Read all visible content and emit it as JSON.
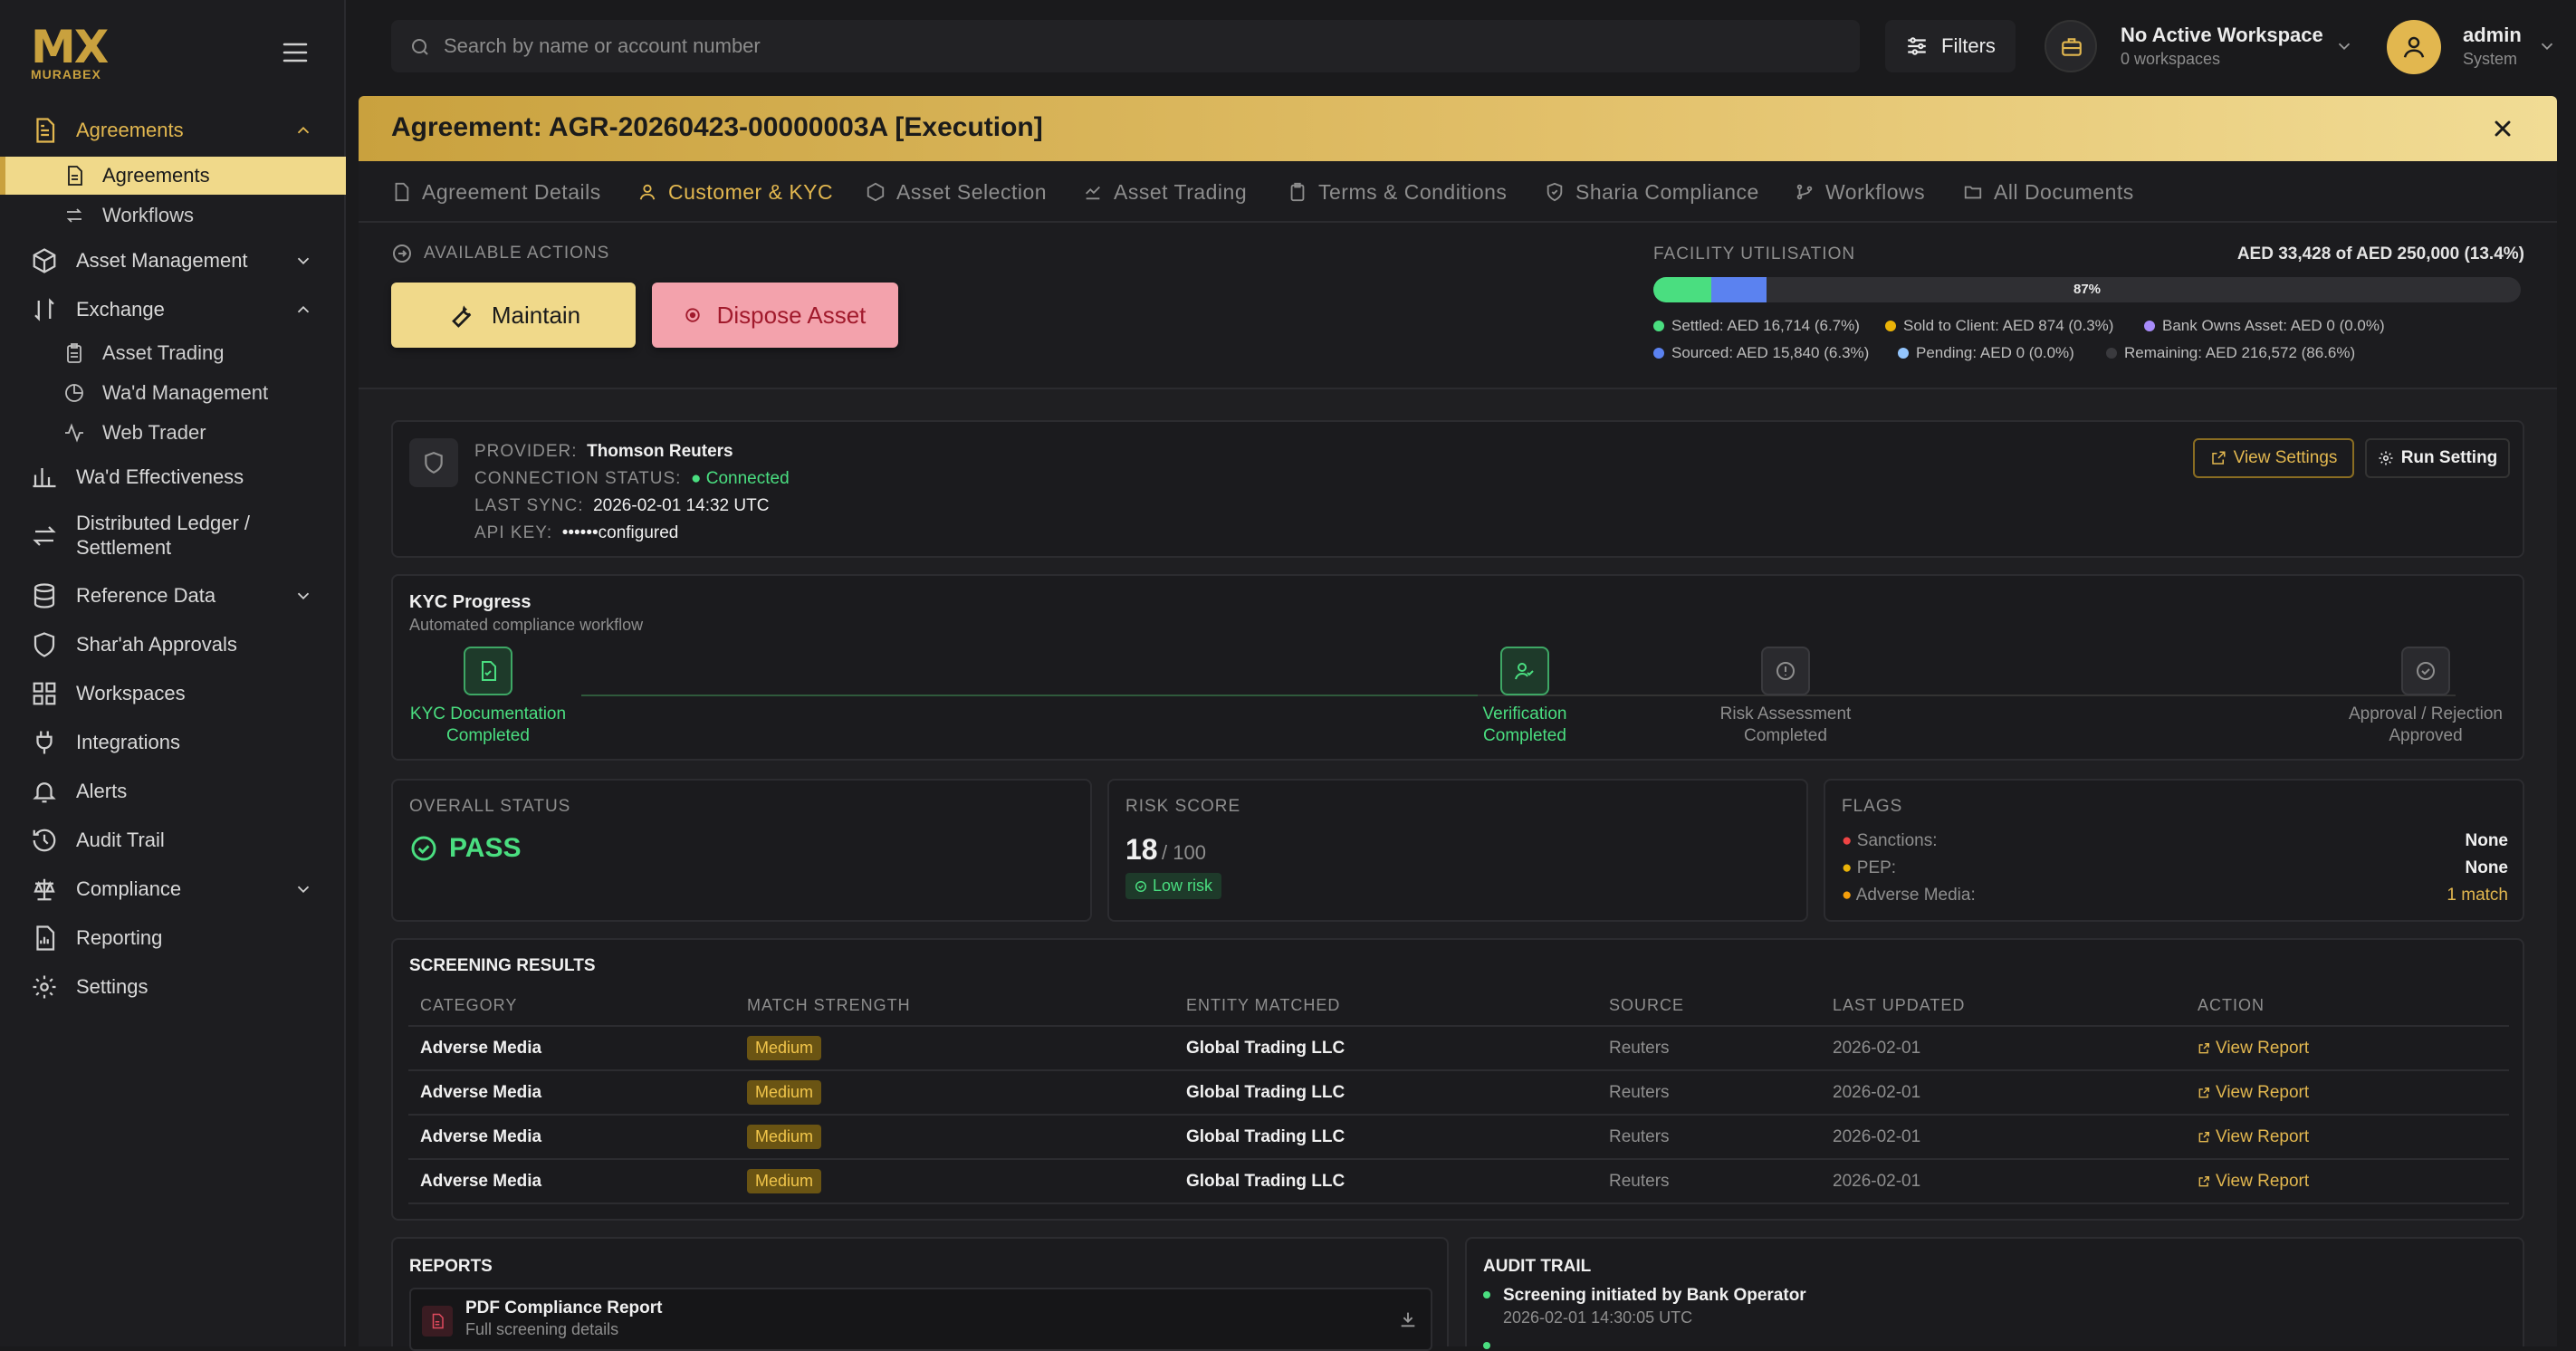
{
  "app": {
    "logo_mark": "MX",
    "logo_name": "MURABEX"
  },
  "sidebar": {
    "groups": [
      {
        "label": "Agreements",
        "icon": "document-icon",
        "expanded": true,
        "children": [
          {
            "label": "Agreements",
            "icon": "document-icon",
            "active": true
          },
          {
            "label": "Workflows",
            "icon": "arrows-icon"
          }
        ]
      },
      {
        "label": "Asset Management",
        "icon": "cube-icon",
        "expanded": false
      },
      {
        "label": "Exchange",
        "icon": "sort-icon",
        "expanded": true,
        "children": [
          {
            "label": "Asset Trading",
            "icon": "clipboard-icon"
          },
          {
            "label": "Wa'd Management",
            "icon": "pie-icon"
          },
          {
            "label": "Web Trader",
            "icon": "activity-icon"
          }
        ]
      },
      {
        "label": "Wa'd Effectiveness",
        "icon": "bar-chart-icon"
      },
      {
        "label": "Distributed Ledger / Settlement",
        "label_line1": "Distributed Ledger /",
        "label_line2": "Settlement",
        "icon": "exchange-icon"
      },
      {
        "label": "Reference Data",
        "icon": "database-icon",
        "expanded": false
      },
      {
        "label": "Shar'ah Approvals",
        "icon": "shield-icon"
      },
      {
        "label": "Workspaces",
        "icon": "grid-icon"
      },
      {
        "label": "Integrations",
        "icon": "plug-icon"
      },
      {
        "label": "Alerts",
        "icon": "bell-icon"
      },
      {
        "label": "Audit Trail",
        "icon": "history-icon"
      },
      {
        "label": "Compliance",
        "icon": "scale-icon",
        "expanded": false
      },
      {
        "label": "Reporting",
        "icon": "report-icon"
      },
      {
        "label": "Settings",
        "icon": "gear-icon"
      }
    ]
  },
  "topbar": {
    "search_placeholder": "Search by name or account number",
    "filters_label": "Filters",
    "workspace_title": "No Active Workspace",
    "workspace_sub": "0 workspaces",
    "user_name": "admin",
    "user_role": "System"
  },
  "agreement": {
    "title": "Agreement: AGR-20260423-00000003A [Execution]",
    "tabs": [
      {
        "label": "Agreement Details",
        "icon": "file-icon"
      },
      {
        "label": "Customer & KYC",
        "icon": "user-icon",
        "active": true
      },
      {
        "label": "Asset Selection",
        "icon": "box-icon"
      },
      {
        "label": "Asset Trading",
        "icon": "hand-icon"
      },
      {
        "label": "Terms & Conditions",
        "icon": "clipboard-icon"
      },
      {
        "label": "Sharia Compliance",
        "icon": "shield-check-icon"
      },
      {
        "label": "Workflows",
        "icon": "git-branch-icon"
      },
      {
        "label": "All Documents",
        "icon": "folder-icon"
      }
    ]
  },
  "actions": {
    "heading": "AVAILABLE ACTIONS",
    "maintain_label": "Maintain",
    "dispose_label": "Dispose Asset"
  },
  "facility": {
    "heading": "FACILITY UTILISATION",
    "summary": "AED 33,428 of AED 250,000 (13.4%)",
    "bar_label": "87%",
    "settled_fraction": 0.067,
    "sourced_fraction": 0.063,
    "legend": [
      {
        "text": "Settled: AED 16,714 (6.7%)",
        "color": "#4ade80"
      },
      {
        "text": "Sold to Client: AED 874 (0.3%)",
        "color": "#eab308"
      },
      {
        "text": "Bank Owns Asset: AED 0 (0.0%)",
        "color": "#a78bfa"
      },
      {
        "text": "Sourced: AED 15,840 (6.3%)",
        "color": "#5b82f0"
      },
      {
        "text": "Pending: AED 0 (0.0%)",
        "color": "#93c5fd"
      },
      {
        "text": "Remaining: AED 216,572 (86.6%)",
        "color": "#3a3a3e"
      }
    ]
  },
  "provider": {
    "provider_key": "PROVIDER:",
    "provider_val": "Thomson Reuters",
    "status_key": "CONNECTION STATUS:",
    "status_val": "Connected",
    "sync_key": "LAST SYNC:",
    "sync_val": "2026-02-01 14:32 UTC",
    "api_key": "API KEY:",
    "api_val": "••••••configured",
    "view_settings": "View Settings",
    "run_setting": "Run Setting"
  },
  "kyc": {
    "title": "KYC Progress",
    "subtitle": "Automated compliance workflow",
    "steps": [
      {
        "label": "KYC Documentation",
        "status": "Completed",
        "done": true,
        "icon": "file-check-icon"
      },
      {
        "label": "Verification",
        "status": "Completed",
        "done": true,
        "icon": "user-check-icon"
      },
      {
        "label": "Risk Assessment",
        "status": "Completed",
        "done": false,
        "icon": "alert-circle-icon"
      },
      {
        "label": "Approval / Rejection",
        "status": "Approved",
        "done": false,
        "icon": "check-circle-icon"
      }
    ]
  },
  "status": {
    "overall_heading": "OVERALL STATUS",
    "overall_value": "PASS",
    "risk_heading": "RISK SCORE",
    "risk_value": "18",
    "risk_max": "/ 100",
    "risk_badge": "Low risk",
    "flags_heading": "FLAGS",
    "flags": [
      {
        "label": "Sanctions:",
        "value": "None",
        "dot": "#ef4444",
        "highlight": false
      },
      {
        "label": "PEP:",
        "value": "None",
        "dot": "#eab308",
        "highlight": false
      },
      {
        "label": "Adverse Media:",
        "value": "1 match",
        "dot": "#f59e0b",
        "highlight": true
      }
    ]
  },
  "screening": {
    "heading": "SCREENING RESULTS",
    "columns": [
      "CATEGORY",
      "MATCH STRENGTH",
      "ENTITY MATCHED",
      "SOURCE",
      "LAST UPDATED",
      "ACTION"
    ],
    "rows": [
      {
        "category": "Adverse Media",
        "strength": "Medium",
        "entity": "Global Trading LLC",
        "source": "Reuters",
        "updated": "2026-02-01",
        "action": "View Report"
      },
      {
        "category": "Adverse Media",
        "strength": "Medium",
        "entity": "Global Trading LLC",
        "source": "Reuters",
        "updated": "2026-02-01",
        "action": "View Report"
      },
      {
        "category": "Adverse Media",
        "strength": "Medium",
        "entity": "Global Trading LLC",
        "source": "Reuters",
        "updated": "2026-02-01",
        "action": "View Report"
      },
      {
        "category": "Adverse Media",
        "strength": "Medium",
        "entity": "Global Trading LLC",
        "source": "Reuters",
        "updated": "2026-02-01",
        "action": "View Report"
      }
    ]
  },
  "reports": {
    "heading": "REPORTS",
    "items": [
      {
        "title": "PDF Compliance Report",
        "subtitle": "Full screening details"
      }
    ]
  },
  "audit": {
    "heading": "AUDIT TRAIL",
    "items": [
      {
        "title": "Screening initiated by Bank Operator",
        "time": "2026-02-01 14:30:05 UTC"
      }
    ]
  }
}
